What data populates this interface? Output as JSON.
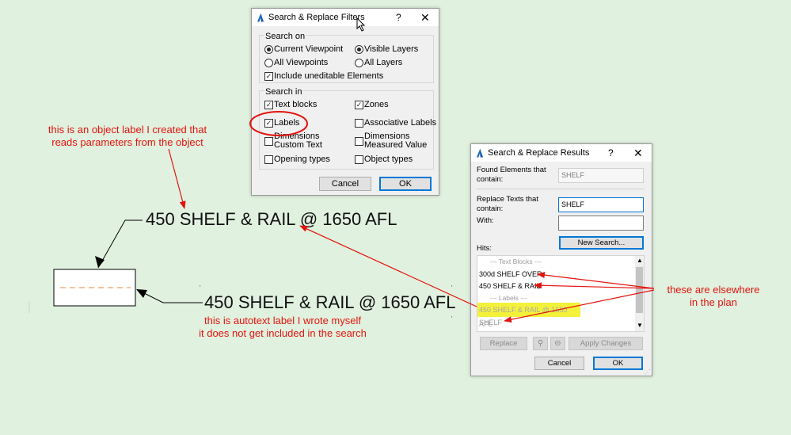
{
  "filters_dialog": {
    "title": "Search & Replace Filters",
    "help": "?",
    "close": "✕",
    "search_on": {
      "heading": "Search on",
      "current_viewpoint": "Current Viewpoint",
      "all_viewpoints": "All Viewpoints",
      "visible_layers": "Visible Layers",
      "all_layers": "All Layers",
      "include_uneditable": "Include uneditable Elements"
    },
    "search_in": {
      "heading": "Search in",
      "text_blocks": "Text blocks",
      "zones": "Zones",
      "labels": "Labels",
      "associative_labels": "Associative Labels",
      "dimensions_custom_text": "Dimensions\nCustom Text",
      "dimensions_measured_value": "Dimensions\nMeasured Value",
      "opening_types": "Opening types",
      "object_types": "Object types"
    },
    "cancel": "Cancel",
    "ok": "OK"
  },
  "results_dialog": {
    "title": "Search & Replace Results",
    "help": "?",
    "close": "✕",
    "found_label": "Found Elements that\ncontain:",
    "found_value": "SHELF",
    "replace_label": "Replace Texts that\ncontain:",
    "replace_value": "SHELF",
    "with_label": "With:",
    "with_value": "",
    "new_search": "New Search...",
    "hits_label": "Hits:",
    "hits": [
      {
        "text": "---  Text Blocks  ---",
        "kind": "header"
      },
      {
        "text": "300d SHELF OVER",
        "kind": "item"
      },
      {
        "text": "450 SHELF & RAIL",
        "kind": "item"
      },
      {
        "text": "---  Labels  ---",
        "kind": "header"
      },
      {
        "text": "450 SHELF & RAIL @ 1650 AFL",
        "kind": "highlight"
      },
      {
        "text": "SHELF",
        "kind": "dim"
      }
    ],
    "replace": "Replace",
    "apply_changes": "Apply Changes",
    "cancel": "Cancel",
    "ok": "OK"
  },
  "canvas": {
    "object_label": "450 SHELF & RAIL @ 1650 AFL",
    "autotext_label": "450 SHELF & RAIL @ 1650 AFL"
  },
  "annotations": {
    "object_note": "this is an object label I created that\nreads parameters from the object",
    "autotext_note": "this is autotext label I wrote myself\nit does not get included in the search",
    "elsewhere_note": "these are elsewhere\nin the plan"
  },
  "colors": {
    "background": "#e1f1df",
    "annotation_red": "#e3140e",
    "highlight_yellow": "#f4f13a",
    "accent_blue": "#0078d7"
  }
}
